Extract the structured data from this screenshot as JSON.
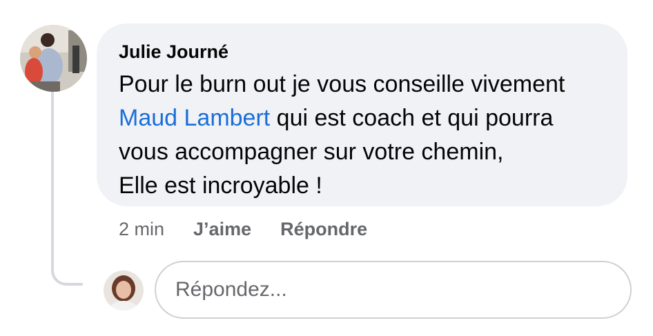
{
  "comment": {
    "author": "Julie Journé",
    "text": {
      "line1": "Pour le burn out je vous conseille vivement",
      "mention": "Maud Lambert",
      "line2_rest": " qui est coach et qui pourra",
      "line3": "vous accompagner sur votre chemin,",
      "line4": "Elle est incroyable !"
    },
    "time": "2 min",
    "like_label": "J’aime",
    "reply_label": "Répondre"
  },
  "reply_box": {
    "placeholder": "Répondez..."
  },
  "colors": {
    "bubble": "#f0f2f5",
    "mention": "#1a6ed8",
    "meta": "#65676b",
    "thread_line": "#d5d8dd"
  }
}
